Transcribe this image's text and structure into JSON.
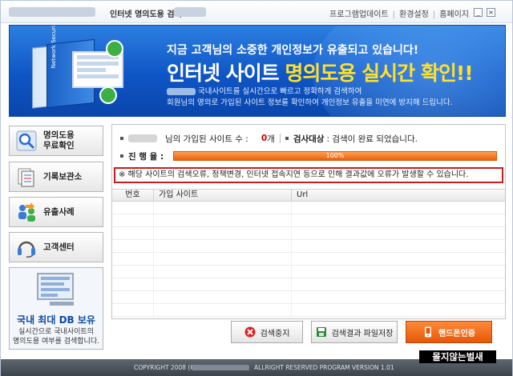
{
  "titlebar": {
    "title": "인터넷 명의도용 검색",
    "links": [
      "프로그램업데이트",
      "환경설정",
      "홈페이지"
    ],
    "min_icon": "minimize-icon",
    "close_icon": "close-icon"
  },
  "banner": {
    "line1": "지금 고객님의 소중한 개인정보가 유출되고 있습니다!",
    "line2a": "인터넷 사이트 ",
    "line2b": "명의도용 실시간 확인!!",
    "line3": "국내사이트를 실시간으로 빠르고 정확하게 검색하여",
    "line4": "회원님의 명의로 가입된 사이트 정보를 확인하여 개인정보 유출을 미연에 방지해 드립니다.",
    "product_text": "Network Security"
  },
  "sidebar": {
    "items": [
      {
        "label_line1": "명의도용",
        "label_line2": "무료확인",
        "icon": "magnifier-icon"
      },
      {
        "label": "기록보관소",
        "icon": "document-archive-icon"
      },
      {
        "label": "유출사례",
        "icon": "people-share-icon"
      },
      {
        "label": "고객센터",
        "icon": "headset-icon"
      }
    ],
    "db_promo": {
      "title": "국내 최대 DB 보유",
      "desc1": "실시간으로 국내사이트의",
      "desc2": "명의도용 여부를 검색합니다."
    }
  },
  "status": {
    "sites_label": "님의 가입된 사이트 수 :",
    "sites_count": "0",
    "sites_unit": "개",
    "target_label": "검사대상",
    "target_value": ": 검색이 완료 되었습니다.",
    "progress_label": "진 행 율 :",
    "progress_value": 1.0,
    "progress_text": "100%"
  },
  "warning": "※ 해당 사이트의 검색오류, 정책변경, 인터넷 접속지연 등으로 인해 결과값에 오류가 발생할 수 있습니다.",
  "table": {
    "columns": [
      "번호",
      "가입 사이트",
      "Url"
    ]
  },
  "buttons": {
    "stop": "검색중지",
    "save": "검색결과 파일저장",
    "phone": "핸드폰인증"
  },
  "footer": {
    "left": "COPYRIGHT 2008 (C)",
    "right": "ALLRIGHT RESERVED PROGRAM VERSION 1.01"
  },
  "stamp": "몰지않는벌새",
  "colors": {
    "banner": "#1a63cf",
    "accent_red": "#d40000",
    "progress": "#f07a22",
    "highlight": "#ffe12a"
  }
}
